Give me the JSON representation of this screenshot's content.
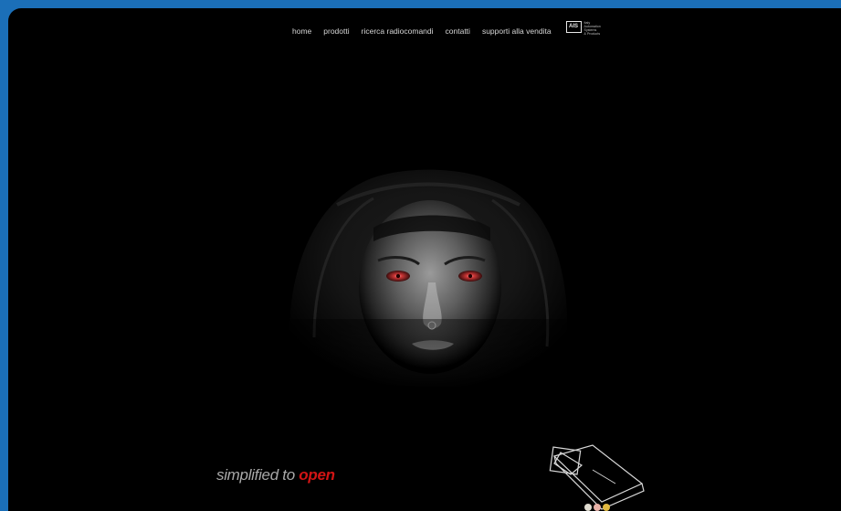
{
  "nav": {
    "items": [
      "home",
      "prodotti",
      "ricerca radiocomandi",
      "contatti",
      "supporti alla vendita"
    ]
  },
  "logo": {
    "mark": "AIS",
    "lines": [
      "Italy",
      "Automation",
      "Systems",
      "& Products"
    ]
  },
  "tagline": {
    "prefix": "simplified to ",
    "highlight": "open"
  },
  "colors": {
    "page_background": "#1b6fb8",
    "frame_background": "#000000",
    "nav_text": "#d6d6d6",
    "tagline_text": "#a9a9a9",
    "highlight": "#d11414",
    "eye_glow": "#c72a2a"
  },
  "slider": {
    "dots": [
      "#e0dcd0",
      "#e8b2a8",
      "#e0b840"
    ]
  }
}
